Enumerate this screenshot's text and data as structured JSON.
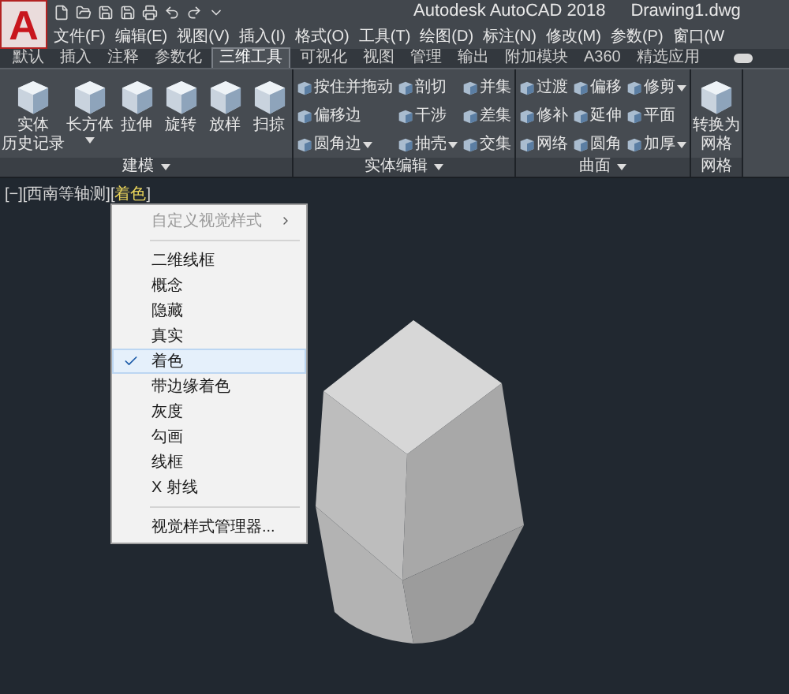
{
  "app": {
    "logo": "A",
    "title": "Autodesk AutoCAD 2018",
    "file": "Drawing1.dwg"
  },
  "menubar": [
    "文件(F)",
    "编辑(E)",
    "视图(V)",
    "插入(I)",
    "格式(O)",
    "工具(T)",
    "绘图(D)",
    "标注(N)",
    "修改(M)",
    "参数(P)",
    "窗口(W"
  ],
  "tabs": [
    {
      "label": "默认",
      "selected": false
    },
    {
      "label": "插入",
      "selected": false
    },
    {
      "label": "注释",
      "selected": false
    },
    {
      "label": "参数化",
      "selected": false
    },
    {
      "label": "三维工具",
      "selected": true
    },
    {
      "label": "可视化",
      "selected": false
    },
    {
      "label": "视图",
      "selected": false
    },
    {
      "label": "管理",
      "selected": false
    },
    {
      "label": "输出",
      "selected": false
    },
    {
      "label": "附加模块",
      "selected": false
    },
    {
      "label": "A360",
      "selected": false
    },
    {
      "label": "精选应用",
      "selected": false
    }
  ],
  "panels": [
    {
      "title": "建模",
      "kind": "large",
      "tools": [
        {
          "lines": [
            "实体",
            "历史记录"
          ],
          "dropdown": false
        },
        {
          "lines": [
            "长方体"
          ],
          "dropdown": true
        },
        {
          "lines": [
            "拉伸"
          ],
          "dropdown": false
        },
        {
          "lines": [
            "旋转"
          ],
          "dropdown": false
        },
        {
          "lines": [
            "放样"
          ],
          "dropdown": false
        },
        {
          "lines": [
            "扫掠"
          ],
          "dropdown": false
        }
      ]
    },
    {
      "title": "实体编辑",
      "kind": "small",
      "columns": [
        [
          {
            "label": "按住并拖动",
            "dropdown": false
          },
          {
            "label": "偏移边",
            "dropdown": false
          },
          {
            "label": "圆角边",
            "dropdown": true
          }
        ],
        [
          {
            "label": "剖切",
            "dropdown": false
          },
          {
            "label": "干涉",
            "dropdown": false
          },
          {
            "label": "抽壳",
            "dropdown": true
          }
        ],
        [
          {
            "label": "并集",
            "dropdown": false
          },
          {
            "label": "差集",
            "dropdown": false
          },
          {
            "label": "交集",
            "dropdown": false
          }
        ]
      ]
    },
    {
      "title": "曲面",
      "kind": "small",
      "columns": [
        [
          {
            "label": "过渡",
            "dropdown": false
          },
          {
            "label": "修补",
            "dropdown": false
          },
          {
            "label": "网络",
            "dropdown": false
          }
        ],
        [
          {
            "label": "偏移",
            "dropdown": false
          },
          {
            "label": "延伸",
            "dropdown": false
          },
          {
            "label": "圆角",
            "dropdown": false
          }
        ],
        [
          {
            "label": "修剪",
            "dropdown": true
          },
          {
            "label": "平面",
            "dropdown": false
          },
          {
            "label": "加厚",
            "dropdown": true
          }
        ]
      ]
    },
    {
      "title": "网格",
      "kind": "large",
      "tools": [
        {
          "lines": [
            "转换为",
            "网格"
          ],
          "dropdown": false
        }
      ]
    }
  ],
  "viewport": {
    "label_parts": [
      "[−][西南等轴测][",
      "着色",
      "]"
    ]
  },
  "menu": [
    {
      "kind": "item",
      "label": "自定义视觉样式",
      "disabled": true,
      "submenu": true,
      "checked": false
    },
    {
      "kind": "separator"
    },
    {
      "kind": "item",
      "label": "二维线框",
      "disabled": false,
      "submenu": false,
      "checked": false
    },
    {
      "kind": "item",
      "label": "概念",
      "disabled": false,
      "submenu": false,
      "checked": false
    },
    {
      "kind": "item",
      "label": "隐藏",
      "disabled": false,
      "submenu": false,
      "checked": false
    },
    {
      "kind": "item",
      "label": "真实",
      "disabled": false,
      "submenu": false,
      "checked": false
    },
    {
      "kind": "item",
      "label": "着色",
      "disabled": false,
      "submenu": false,
      "checked": true
    },
    {
      "kind": "item",
      "label": "带边缘着色",
      "disabled": false,
      "submenu": false,
      "checked": false
    },
    {
      "kind": "item",
      "label": "灰度",
      "disabled": false,
      "submenu": false,
      "checked": false
    },
    {
      "kind": "item",
      "label": "勾画",
      "disabled": false,
      "submenu": false,
      "checked": false
    },
    {
      "kind": "item",
      "label": "线框",
      "disabled": false,
      "submenu": false,
      "checked": false
    },
    {
      "kind": "item",
      "label": "X 射线",
      "disabled": false,
      "submenu": false,
      "checked": false
    },
    {
      "kind": "separator"
    },
    {
      "kind": "item",
      "label": "视觉样式管理器...",
      "disabled": false,
      "submenu": false,
      "checked": false
    }
  ]
}
